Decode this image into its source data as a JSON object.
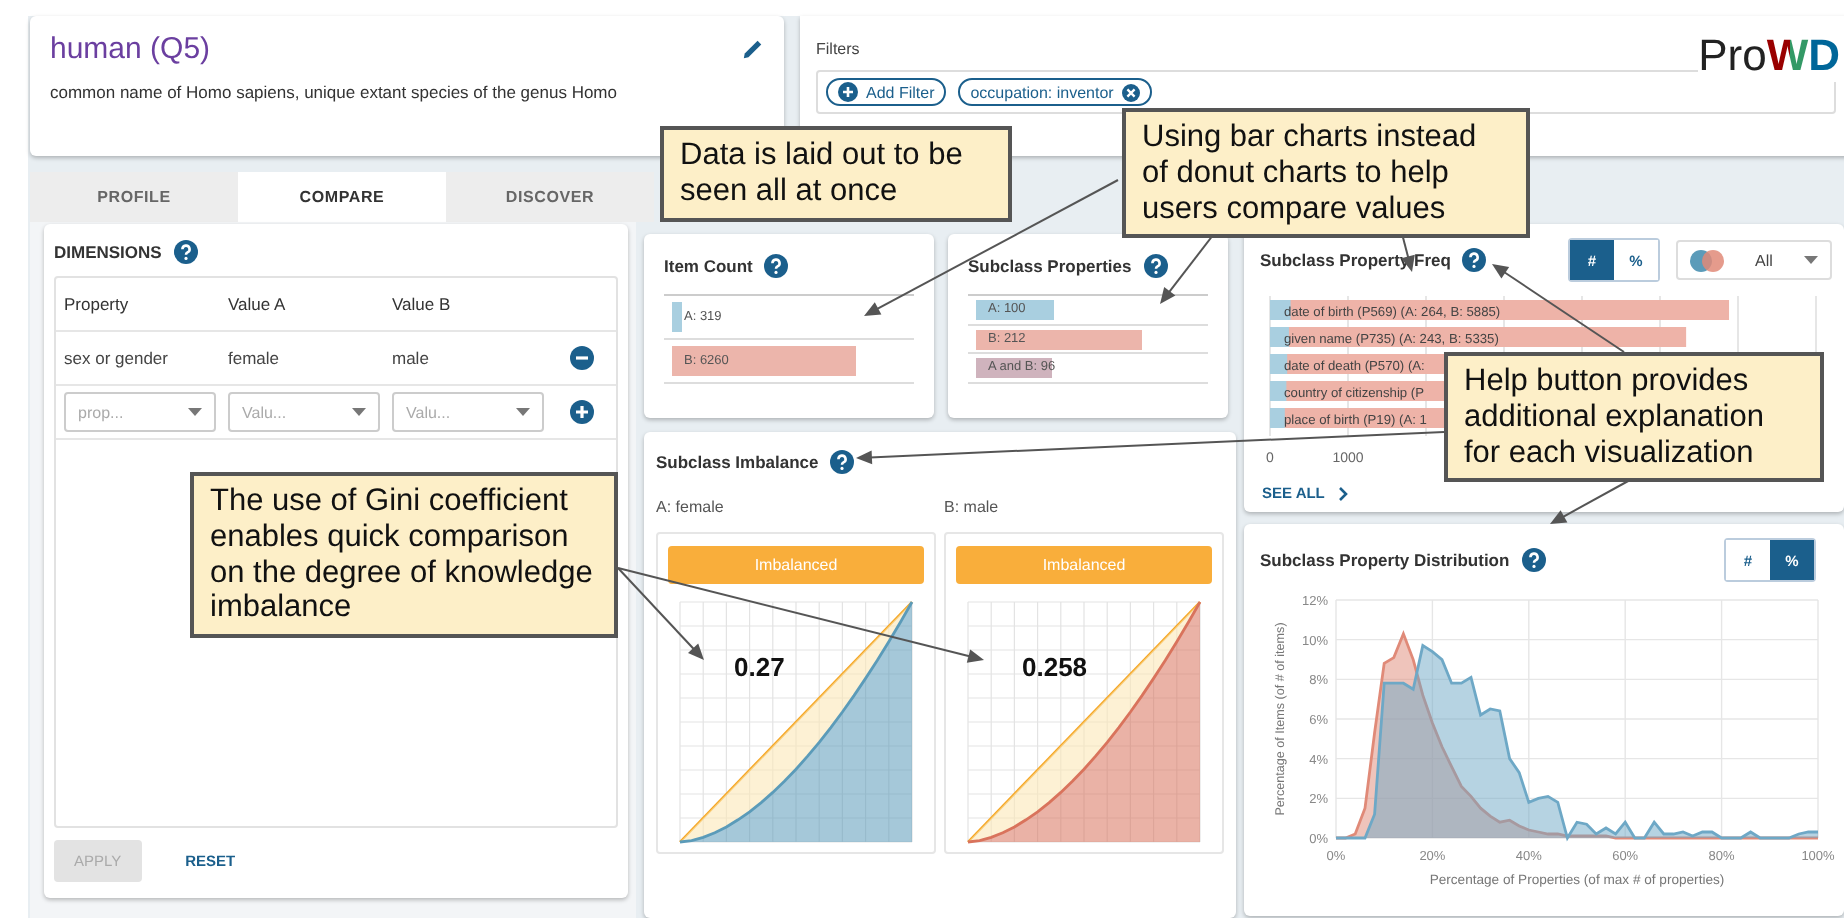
{
  "entity": {
    "title": "human (Q5)",
    "description": "common name of Homo sapiens, unique extant species of the genus Homo"
  },
  "filters": {
    "label": "Filters",
    "add_button": "Add Filter",
    "chips": [
      "occupation: inventor"
    ]
  },
  "logo": "Pro**WD**",
  "tabs": [
    {
      "label": "PROFILE",
      "selected": false
    },
    {
      "label": "COMPARE",
      "selected": true
    },
    {
      "label": "DISCOVER",
      "selected": false
    }
  ],
  "dimensions": {
    "title": "DIMENSIONS",
    "columns": [
      "Property",
      "Value A",
      "Value B"
    ],
    "rows": [
      [
        "sex or gender",
        "female",
        "male"
      ]
    ],
    "new_row": [
      "prop...",
      "Valu...",
      "Valu..."
    ],
    "apply": {
      "label": "APPLY",
      "disabled": true
    },
    "reset": "RESET"
  },
  "item_count": {
    "title": "Item Count",
    "bars": [
      {
        "label": "A: 319",
        "color": "#a9cfe0"
      },
      {
        "label": "B: 6260",
        "color": "#ecb5ab"
      }
    ]
  },
  "subclass_properties": {
    "title": "Subclass Properties",
    "bars": [
      {
        "label": "A: 100",
        "color": "#a9cfe0"
      },
      {
        "label": "B: 212",
        "color": "#ecb5ab"
      },
      {
        "label": "A and B: 96",
        "color": "#cfb3bd"
      }
    ]
  },
  "imbalance": {
    "title": "Subclass Imbalance",
    "panels": [
      {
        "label": "A: female",
        "status": "Imbalanced",
        "gini": "0.27",
        "color": "#5b9bb9"
      },
      {
        "label": "B: male",
        "status": "Imbalanced",
        "gini": "0.258",
        "color": "#d9735c"
      }
    ]
  },
  "property_freq": {
    "title": "Subclass Property Freq",
    "toggles": [
      {
        "label": "#",
        "selected": true
      },
      {
        "label": "%",
        "selected": false
      }
    ],
    "set_filter": "All",
    "see_all": "SEE ALL",
    "rows": [
      "date of birth (P569) (A: 264, B: 5885)",
      "given name (P735) (A: 243, B: 5335)",
      "date of death (P570) (A:",
      "country of citizenship (P",
      "place of birth (P19) (A: 1"
    ],
    "ticks": [
      "0",
      "1000"
    ]
  },
  "distribution": {
    "title": "Subclass Property Distribution",
    "toggles": [
      {
        "label": "#",
        "selected": false
      },
      {
        "label": "%",
        "selected": true
      }
    ],
    "chart_data": {
      "type": "area",
      "grid": true,
      "xlabel": "Percentage of Properties (of max # of properties)",
      "ylabel": "Percentage of Items (of # of items)",
      "x": [
        0,
        2,
        4,
        6,
        8,
        10,
        12,
        14,
        16,
        18,
        20,
        22,
        24,
        26,
        28,
        30,
        32,
        34,
        36,
        38,
        40,
        42,
        44,
        46,
        48,
        50,
        52,
        54,
        56,
        58,
        60,
        62,
        64,
        66,
        68,
        70,
        72,
        74,
        76,
        78,
        80,
        82,
        84,
        86,
        88,
        90,
        92,
        94,
        96,
        98,
        100
      ],
      "series": [
        {
          "color": "#e08a78",
          "values": [
            0,
            0,
            0.2,
            1.5,
            5.3,
            8.8,
            9.1,
            10.3,
            9.0,
            7.2,
            5.8,
            4.6,
            3.6,
            2.6,
            2.1,
            1.5,
            1.1,
            0.8,
            0.9,
            0.6,
            0.4,
            0.3,
            0.2,
            0.2,
            0.1,
            0.1,
            0.1,
            0.1,
            0.1,
            0,
            0,
            0,
            0,
            0,
            0,
            0,
            0,
            0,
            0,
            0,
            0,
            0,
            0,
            0,
            0,
            0,
            0,
            0,
            0,
            0,
            0
          ]
        },
        {
          "color": "#6ea8c6",
          "values": [
            0,
            0,
            0,
            0,
            1.2,
            7.8,
            7.8,
            7.8,
            7.5,
            9.7,
            9.4,
            9.0,
            7.8,
            7.8,
            8.1,
            6.2,
            6.5,
            6.4,
            4.0,
            3.3,
            1.8,
            2.0,
            2.1,
            1.8,
            0,
            0.8,
            0.7,
            0.2,
            0.5,
            0.2,
            0.8,
            0,
            0,
            0.8,
            0.2,
            0.2,
            0.3,
            0.1,
            0.3,
            0.3,
            0,
            0,
            0,
            0.3,
            0,
            0,
            0,
            0,
            0.2,
            0.3,
            0.3
          ]
        }
      ],
      "xlim": [
        0,
        100
      ],
      "ylim": [
        0,
        12
      ],
      "xticks": [
        {
          "value": 0,
          "label": "0%"
        },
        {
          "value": 20,
          "label": "20%"
        },
        {
          "value": 40,
          "label": "40%"
        },
        {
          "value": 60,
          "label": "60%"
        },
        {
          "value": 80,
          "label": "80%"
        },
        {
          "value": 100,
          "label": "100%"
        }
      ],
      "yticks": [
        {
          "value": 0,
          "label": "0%"
        },
        {
          "value": 2,
          "label": "2%"
        },
        {
          "value": 4,
          "label": "4%"
        },
        {
          "value": 6,
          "label": "6%"
        },
        {
          "value": 8,
          "label": "8%"
        },
        {
          "value": 10,
          "label": "10%"
        },
        {
          "value": 12,
          "label": "12%"
        }
      ]
    }
  },
  "callouts": [
    "Data is laid out to be seen all at once",
    "Using bar charts instead of donut charts to help users compare values",
    "Help button provides additional explanation for each visualization",
    "The use of Gini coefficient enables quick comparison on the degree of knowledge imbalance"
  ]
}
